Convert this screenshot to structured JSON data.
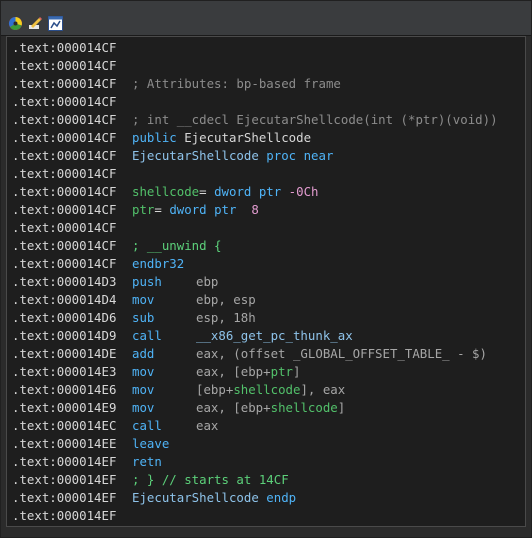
{
  "toolbar": {
    "icons": [
      "color-wheel-icon",
      "edit-pencil-icon",
      "graph-view-icon"
    ]
  },
  "lines": [
    {
      "addr": ".text:000014CF"
    },
    {
      "addr": ".text:000014CF"
    },
    {
      "addr": ".text:000014CF",
      "comment": "; Attributes: bp-based frame"
    },
    {
      "addr": ".text:000014CF"
    },
    {
      "addr": ".text:000014CF",
      "comment": "; int __cdecl EjecutarShellcode(int (*ptr)(void))"
    },
    {
      "addr": ".text:000014CF",
      "kw": "public",
      "name": "EjecutarShellcode"
    },
    {
      "addr": ".text:000014CF",
      "name": "EjecutarShellcode",
      "kw": "proc near"
    },
    {
      "addr": ".text:000014CF"
    },
    {
      "addr": ".text:000014CF",
      "var": "shellcode",
      "eq": "=",
      "type": "dword ptr",
      "off": "-0Ch"
    },
    {
      "addr": ".text:000014CF",
      "var": "ptr",
      "eq": "=",
      "type": "dword ptr",
      "off": " 8"
    },
    {
      "addr": ".text:000014CF"
    },
    {
      "addr": ".text:000014CF",
      "comment_green": "; __unwind {"
    },
    {
      "addr": ".text:000014CF",
      "mnem": "endbr32"
    },
    {
      "addr": ".text:000014D3",
      "mnem": "push",
      "op": "ebp"
    },
    {
      "addr": ".text:000014D4",
      "mnem": "mov",
      "op": "ebp, esp"
    },
    {
      "addr": ".text:000014D6",
      "mnem": "sub",
      "op": "esp, 18h"
    },
    {
      "addr": ".text:000014D9",
      "mnem": "call",
      "func": "__x86_get_pc_thunk_ax"
    },
    {
      "addr": ".text:000014DE",
      "mnem": "add",
      "op": "eax, (offset _GLOBAL_OFFSET_TABLE_ - $)"
    },
    {
      "addr": ".text:000014E3",
      "mnem": "mov",
      "op": "eax, [ebp+",
      "var": "ptr",
      "op2": "]"
    },
    {
      "addr": ".text:000014E6",
      "mnem": "mov",
      "op": "[ebp+",
      "var": "shellcode",
      "op2": "], eax"
    },
    {
      "addr": ".text:000014E9",
      "mnem": "mov",
      "op": "eax, [ebp+",
      "var": "shellcode",
      "op2": "]"
    },
    {
      "addr": ".text:000014EC",
      "mnem": "call",
      "op": "eax"
    },
    {
      "addr": ".text:000014EE",
      "mnem": "leave"
    },
    {
      "addr": ".text:000014EF",
      "mnem": "retn"
    },
    {
      "addr": ".text:000014EF",
      "comment_green": "; } // starts at 14CF"
    },
    {
      "addr": ".text:000014EF",
      "name": "EjecutarShellcode",
      "kw": "endp"
    },
    {
      "addr": ".text:000014EF"
    }
  ]
}
